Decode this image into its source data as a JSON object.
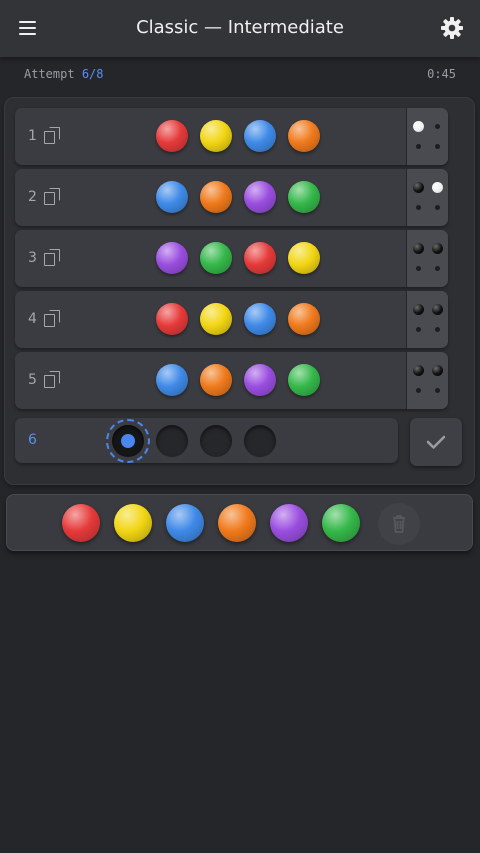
{
  "header": {
    "title": "Classic — Intermediate",
    "menu_icon": "hamburger-menu-icon",
    "settings_icon": "gear-icon"
  },
  "status": {
    "attempt_label": "Attempt",
    "attempt_value": "6/8",
    "timer": "0:45"
  },
  "colors": {
    "red": "#e63a3a",
    "yellow": "#f2d614",
    "blue": "#3f8ae8",
    "orange": "#f07a1c",
    "purple": "#9a4ee0",
    "green": "#35b84a",
    "accent": "#4a86ee"
  },
  "board": {
    "guesses": [
      {
        "number": "1",
        "pegs": [
          "red",
          "yellow",
          "blue",
          "orange"
        ],
        "feedback": [
          "white",
          "empty",
          "empty",
          "empty"
        ]
      },
      {
        "number": "2",
        "pegs": [
          "blue",
          "orange",
          "purple",
          "green"
        ],
        "feedback": [
          "black",
          "white",
          "empty",
          "empty"
        ]
      },
      {
        "number": "3",
        "pegs": [
          "purple",
          "green",
          "red",
          "yellow"
        ],
        "feedback": [
          "black",
          "black",
          "empty",
          "empty"
        ]
      },
      {
        "number": "4",
        "pegs": [
          "red",
          "yellow",
          "blue",
          "orange"
        ],
        "feedback": [
          "black",
          "black",
          "empty",
          "empty"
        ]
      },
      {
        "number": "5",
        "pegs": [
          "blue",
          "orange",
          "purple",
          "green"
        ],
        "feedback": [
          "black",
          "black",
          "empty",
          "empty"
        ]
      }
    ],
    "active_row": {
      "number": "6",
      "slots": [
        "selected",
        "empty",
        "empty",
        "empty"
      ]
    },
    "submit_icon": "checkmark-icon"
  },
  "palette": {
    "colors": [
      "red",
      "yellow",
      "blue",
      "orange",
      "purple",
      "green"
    ],
    "clear_icon": "trash-icon"
  }
}
